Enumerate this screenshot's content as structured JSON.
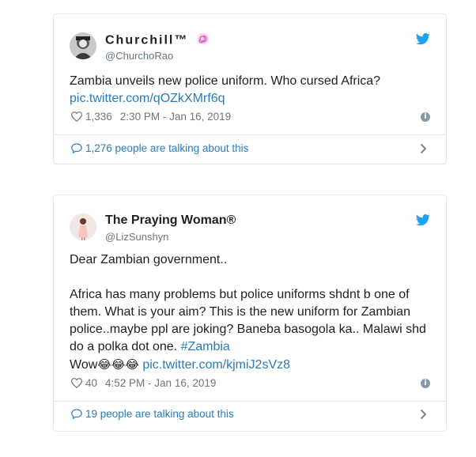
{
  "tweets": [
    {
      "display_name": "Churchill™",
      "handle": "@ChurchoRao",
      "text": "Zambia unveils new police uniform. Who cursed Africa?",
      "link": "pic.twitter.com/qOZkXMrf6q",
      "likes": "1,336",
      "timestamp": "2:30 PM - Jan 16, 2019",
      "talking": "1,276 people are talking about this"
    },
    {
      "display_name": "The Praying Woman®",
      "handle": "@LizSunshyn",
      "text_line1": "Dear Zambian government..",
      "text_line2": "Africa has many problems but police uniforms shdnt b one of",
      "text_line3": "them. What is your aim? This is the new uniform for Zambian",
      "text_line4": "police..maybe ppl are joking? Baneba basogola ka.. Malawi shd",
      "text_line5_pre": "do a polka dot one. ",
      "hashtag": "#Zambia",
      "text_line6_pre": "Wow",
      "emojis": "😂😂😂",
      "link": "pic.twitter.com/kjmiJ2sVz8",
      "likes": "40",
      "timestamp": "4:52 PM - Jan 16, 2019",
      "talking": "19 people are talking about this"
    }
  ],
  "colors": {
    "link": "#2b7bb9",
    "muted": "#697882",
    "border": "#e1e8ed",
    "bird": "#1da1f2"
  },
  "icons": [
    "twitter-bird-icon",
    "heart-icon",
    "info-icon",
    "chat-bubble-icon",
    "chevron-right-icon",
    "swirl-emoji-icon"
  ]
}
